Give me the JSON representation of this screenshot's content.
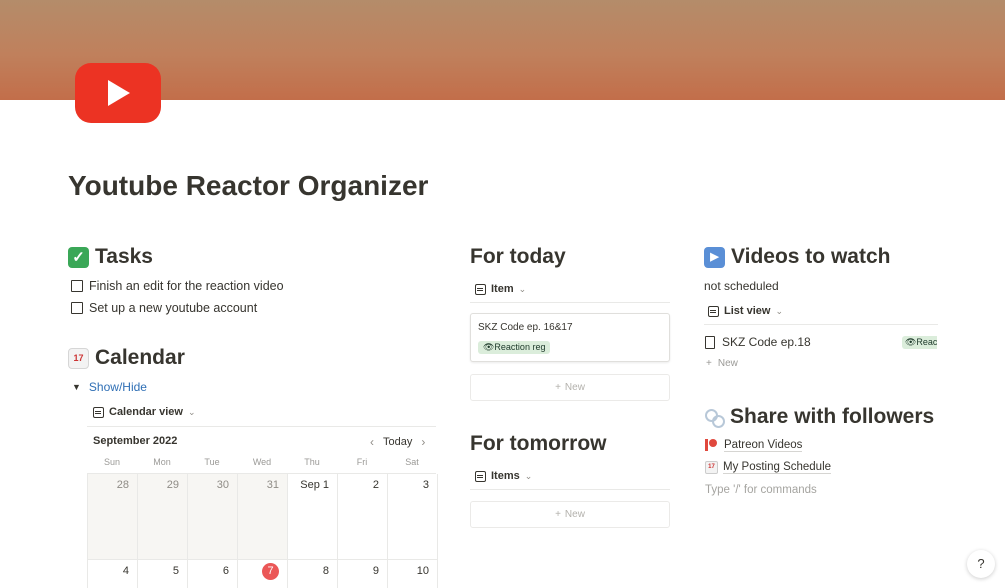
{
  "page": {
    "title": "Youtube Reactor Organizer",
    "cover_colors": [
      "#b48c6a",
      "#c26e4a"
    ],
    "logo_color": "#ec3323"
  },
  "tasks": {
    "heading": "Tasks",
    "icon": "check-mark-emoji",
    "items": [
      {
        "label": "Finish an edit for the reaction video",
        "checked": false
      },
      {
        "label": "Set up a new youtube account",
        "checked": false
      }
    ]
  },
  "calendar": {
    "heading": "Calendar",
    "icon": "calendar-emoji",
    "emoji_day": "17",
    "toggle_label": "Show/Hide",
    "view_label": "Calendar view",
    "month": "September 2022",
    "today_label": "Today",
    "weekdays": [
      "Sun",
      "Mon",
      "Tue",
      "Wed",
      "Thu",
      "Fri",
      "Sat"
    ],
    "week1": [
      "28",
      "29",
      "30",
      "31",
      "Sep 1",
      "2",
      "3"
    ],
    "week2": [
      "4",
      "5",
      "6",
      "7",
      "8",
      "9",
      "10"
    ],
    "today_day": "7"
  },
  "for_today": {
    "heading": "For today",
    "view_label": "Item",
    "card_title": "SKZ Code ep. 16&17",
    "card_tag": "👁Reaction reg",
    "new_label": "New"
  },
  "for_tomorrow": {
    "heading": "For tomorrow",
    "view_label": "Items",
    "new_label": "New"
  },
  "videos": {
    "heading": "Videos to watch",
    "icon": "play-button-emoji",
    "subtitle": "not scheduled",
    "view_label": "List view",
    "item_title": "SKZ Code ep.18",
    "item_tag": "👁Reac",
    "new_label": "New"
  },
  "share": {
    "heading": "Share with followers",
    "icon": "link-emoji",
    "links": [
      "Patreon Videos",
      "My Posting Schedule"
    ],
    "placeholder": "Type '/' for commands"
  },
  "help_label": "?"
}
